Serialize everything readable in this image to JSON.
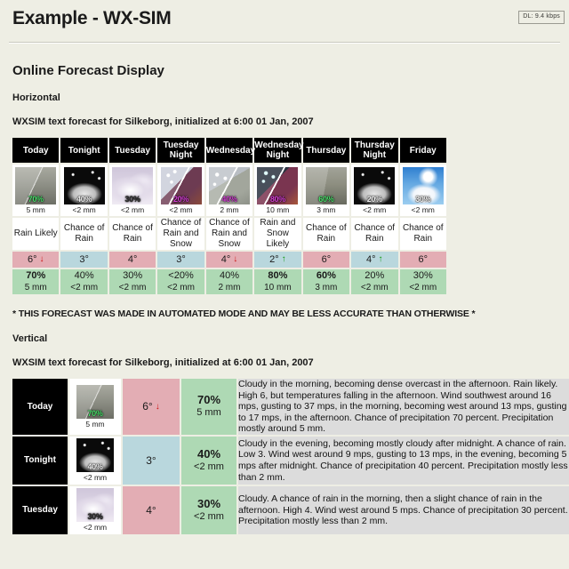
{
  "browser": {
    "download_badge": "DL: 9.4 kbps"
  },
  "header": {
    "title": "Example - WX-SIM"
  },
  "main": {
    "section_title": "Online Forecast Display",
    "horizontal_label": "Horizontal",
    "vertical_label": "Vertical",
    "forecast_line": "WXSIM text forecast for Silkeborg, initialized at 6:00 01 Jan, 2007",
    "disclaimer": "* THIS FORECAST WAS MADE IN AUTOMATED MODE AND MAY BE LESS ACCURATE THAN OTHERWISE *"
  },
  "horizontal_forecast": {
    "columns": [
      {
        "day": "Today",
        "icon": "rain-day-icon",
        "icon_pct": "70%",
        "icon_mm": "5 mm",
        "condition": "Rain Likely",
        "temp": "6°",
        "trend": "down",
        "temp_class": "warm",
        "precip_pct": "70%",
        "precip_strong": true,
        "precip_mm": "5 mm"
      },
      {
        "day": "Tonight",
        "icon": "night-cloud-icon",
        "icon_pct": "40%",
        "icon_mm": "<2 mm",
        "condition": "Chance of Rain",
        "temp": "3°",
        "trend": "none",
        "temp_class": "cool",
        "precip_pct": "40%",
        "precip_strong": false,
        "precip_mm": "<2 mm"
      },
      {
        "day": "Tuesday",
        "icon": "cloud-pale-icon",
        "icon_pct": "30%",
        "icon_mm": "<2 mm",
        "condition": "Chance of Rain",
        "temp": "4°",
        "trend": "none",
        "temp_class": "warm",
        "precip_pct": "30%",
        "precip_strong": false,
        "precip_mm": "<2 mm"
      },
      {
        "day": "Tuesday Night",
        "icon": "rain-snow-magenta-icon",
        "icon_pct": "20%",
        "icon_mm": "<2 mm",
        "condition": "Chance of Rain and Snow",
        "temp": "3°",
        "trend": "none",
        "temp_class": "cool",
        "precip_pct": "<20%",
        "precip_strong": false,
        "precip_mm": "<2 mm"
      },
      {
        "day": "Wednesday",
        "icon": "rain-snow-grey-icon",
        "icon_pct": "40%",
        "icon_mm": "2 mm",
        "condition": "Chance of Rain and Snow",
        "temp": "4°",
        "trend": "down",
        "temp_class": "warm",
        "precip_pct": "40%",
        "precip_strong": false,
        "precip_mm": "2 mm"
      },
      {
        "day": "Wednesday Night",
        "icon": "rain-snow-dark-icon",
        "icon_pct": "80%",
        "icon_mm": "10 mm",
        "condition": "Rain and Snow Likely",
        "temp": "2°",
        "trend": "up",
        "temp_class": "cool",
        "precip_pct": "80%",
        "precip_strong": true,
        "precip_mm": "10 mm"
      },
      {
        "day": "Thursday",
        "icon": "rain-grey-icon",
        "icon_pct": "60%",
        "icon_mm": "3 mm",
        "condition": "Chance of Rain",
        "temp": "6°",
        "trend": "none",
        "temp_class": "warm",
        "precip_pct": "60%",
        "precip_strong": true,
        "precip_mm": "3 mm"
      },
      {
        "day": "Thursday Night",
        "icon": "night-cloud-icon",
        "icon_pct": "20%",
        "icon_mm": "<2 mm",
        "condition": "Chance of Rain",
        "temp": "4°",
        "trend": "up",
        "temp_class": "cool",
        "precip_pct": "20%",
        "precip_strong": false,
        "precip_mm": "<2 mm"
      },
      {
        "day": "Friday",
        "icon": "sun-cloud-icon",
        "icon_pct": "30%",
        "icon_mm": "<2 mm",
        "condition": "Chance of Rain",
        "temp": "6°",
        "trend": "none",
        "temp_class": "warm",
        "precip_pct": "30%",
        "precip_strong": false,
        "precip_mm": "<2 mm"
      }
    ]
  },
  "vertical_forecast": {
    "rows": [
      {
        "day": "Today",
        "icon": "rain-day-icon",
        "icon_pct": "70%",
        "icon_mm": "5 mm",
        "temp": "6°",
        "trend": "down",
        "temp_class": "warm",
        "precip_pct": "70%",
        "precip_mm": "5 mm",
        "text": "Cloudy in the morning, becoming dense overcast in the afternoon. Rain likely. High 6, but temperatures falling in the afternoon. Wind southwest around 16 mps, gusting to 37 mps, in the morning, becoming west around 13 mps, gusting to 17 mps, in the afternoon. Chance of precipitation 70 percent. Precipitation mostly around 5 mm."
      },
      {
        "day": "Tonight",
        "icon": "night-cloud-icon",
        "icon_pct": "40%",
        "icon_mm": "<2 mm",
        "temp": "3°",
        "trend": "none",
        "temp_class": "cool",
        "precip_pct": "40%",
        "precip_mm": "<2 mm",
        "text": "Cloudy in the evening, becoming mostly cloudy after midnight. A chance of rain. Low 3. Wind west around 9 mps, gusting to 13 mps, in the evening, becoming 5 mps after midnight. Chance of precipitation 40 percent. Precipitation mostly less than 2 mm."
      },
      {
        "day": "Tuesday",
        "icon": "cloud-pale-icon",
        "icon_pct": "30%",
        "icon_mm": "<2 mm",
        "temp": "4°",
        "trend": "none",
        "temp_class": "warm",
        "precip_pct": "30%",
        "precip_mm": "<2 mm",
        "text": "Cloudy. A chance of rain in the morning, then a slight chance of rain in the afternoon. High 4. Wind west around 5 mps. Chance of precipitation 30 percent. Precipitation mostly less than 2 mm."
      }
    ]
  },
  "colors": {
    "page_background": "#eeeee4",
    "header_cell": "#000000",
    "temp_warm": "#e3adb4",
    "temp_cool": "#b9d7dd",
    "precip": "#aed9b4",
    "narrative_background": "#dcdcdc",
    "arrow_down": "#cc1111",
    "arrow_up": "#119911"
  }
}
